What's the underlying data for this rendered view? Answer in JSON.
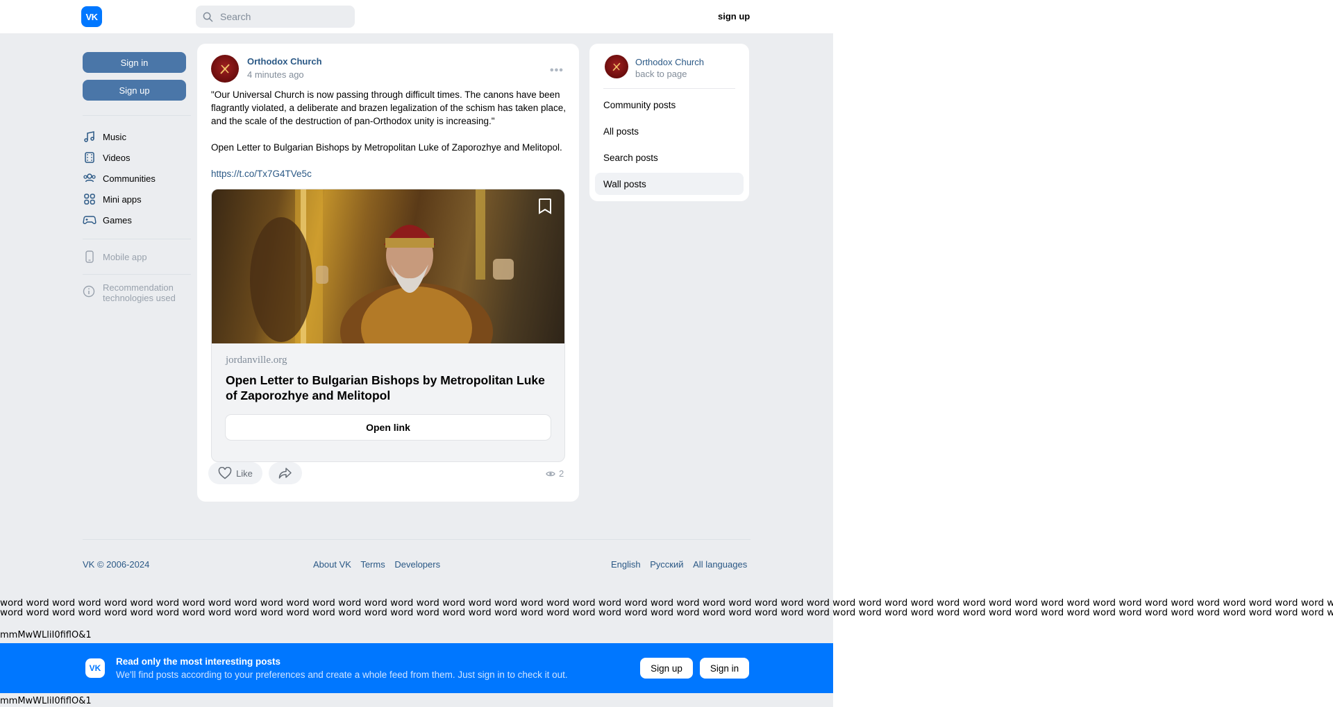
{
  "header": {
    "logo_text": "VK",
    "search_placeholder": "Search",
    "signup_label": "sign up"
  },
  "left_nav": {
    "signin_label": "Sign in",
    "signup_label": "Sign up",
    "items": [
      {
        "label": "Music",
        "icon": "music-icon"
      },
      {
        "label": "Videos",
        "icon": "video-icon"
      },
      {
        "label": "Communities",
        "icon": "communities-icon"
      },
      {
        "label": "Mini apps",
        "icon": "mini-apps-icon"
      },
      {
        "label": "Games",
        "icon": "gamepad-icon"
      }
    ],
    "mobile_app": "Mobile app",
    "recommendation_line1": "Recommendation",
    "recommendation_line2": "technologies used"
  },
  "post": {
    "author": "Orthodox Church",
    "time": "4 minutes ago",
    "text_line1": "\"Our Universal Church is now passing through difficult times. The canons have been flagrantly violated, a deliberate and brazen legalization of the schism has taken place, and the scale of the destruction of pan-Orthodox unity is increasing.\"",
    "text_line2": "Open Letter to Bulgarian Bishops by Metropolitan Luke of Zaporozhye and Melitopol.",
    "link": "https://t.co/Tx7G4TVe5c",
    "attachment": {
      "domain": "jordanville.org",
      "title": "Open Letter to Bulgarian Bishops by Metropolitan Luke of Zaporozhye and Melitopol",
      "button": "Open link"
    },
    "like_label": "Like",
    "views": "2"
  },
  "right_panel": {
    "author": "Orthodox Church",
    "back": "back to page",
    "items": [
      "Community posts",
      "All posts",
      "Search posts",
      "Wall posts"
    ]
  },
  "footer": {
    "copyright": "VK © 2006-2024",
    "links": [
      "About VK",
      "Terms",
      "Developers"
    ],
    "languages": [
      "English",
      "Русский",
      "All languages"
    ]
  },
  "filler": {
    "word_line": "word word word word word word word word word word word word word word word word word word word word word word word word word word word word word word word word word word word word word word word word word word word word word word word word word word word word word word word word word word word word word word word word word word word word word word word word word word word word word word word word word word word word",
    "probe": "mmMwWLliI0fiflO&1"
  },
  "banner": {
    "logo_text": "VK",
    "title": "Read only the most interesting posts",
    "subtitle": "We'll find posts according to your preferences and create a whole feed from them. Just sign in to check it out.",
    "signup_label": "Sign up",
    "signin_label": "Sign in"
  },
  "colors": {
    "accent": "#0077ff",
    "button_blue": "#4a76a8",
    "link": "#2a5885",
    "background": "#ebedf0"
  }
}
